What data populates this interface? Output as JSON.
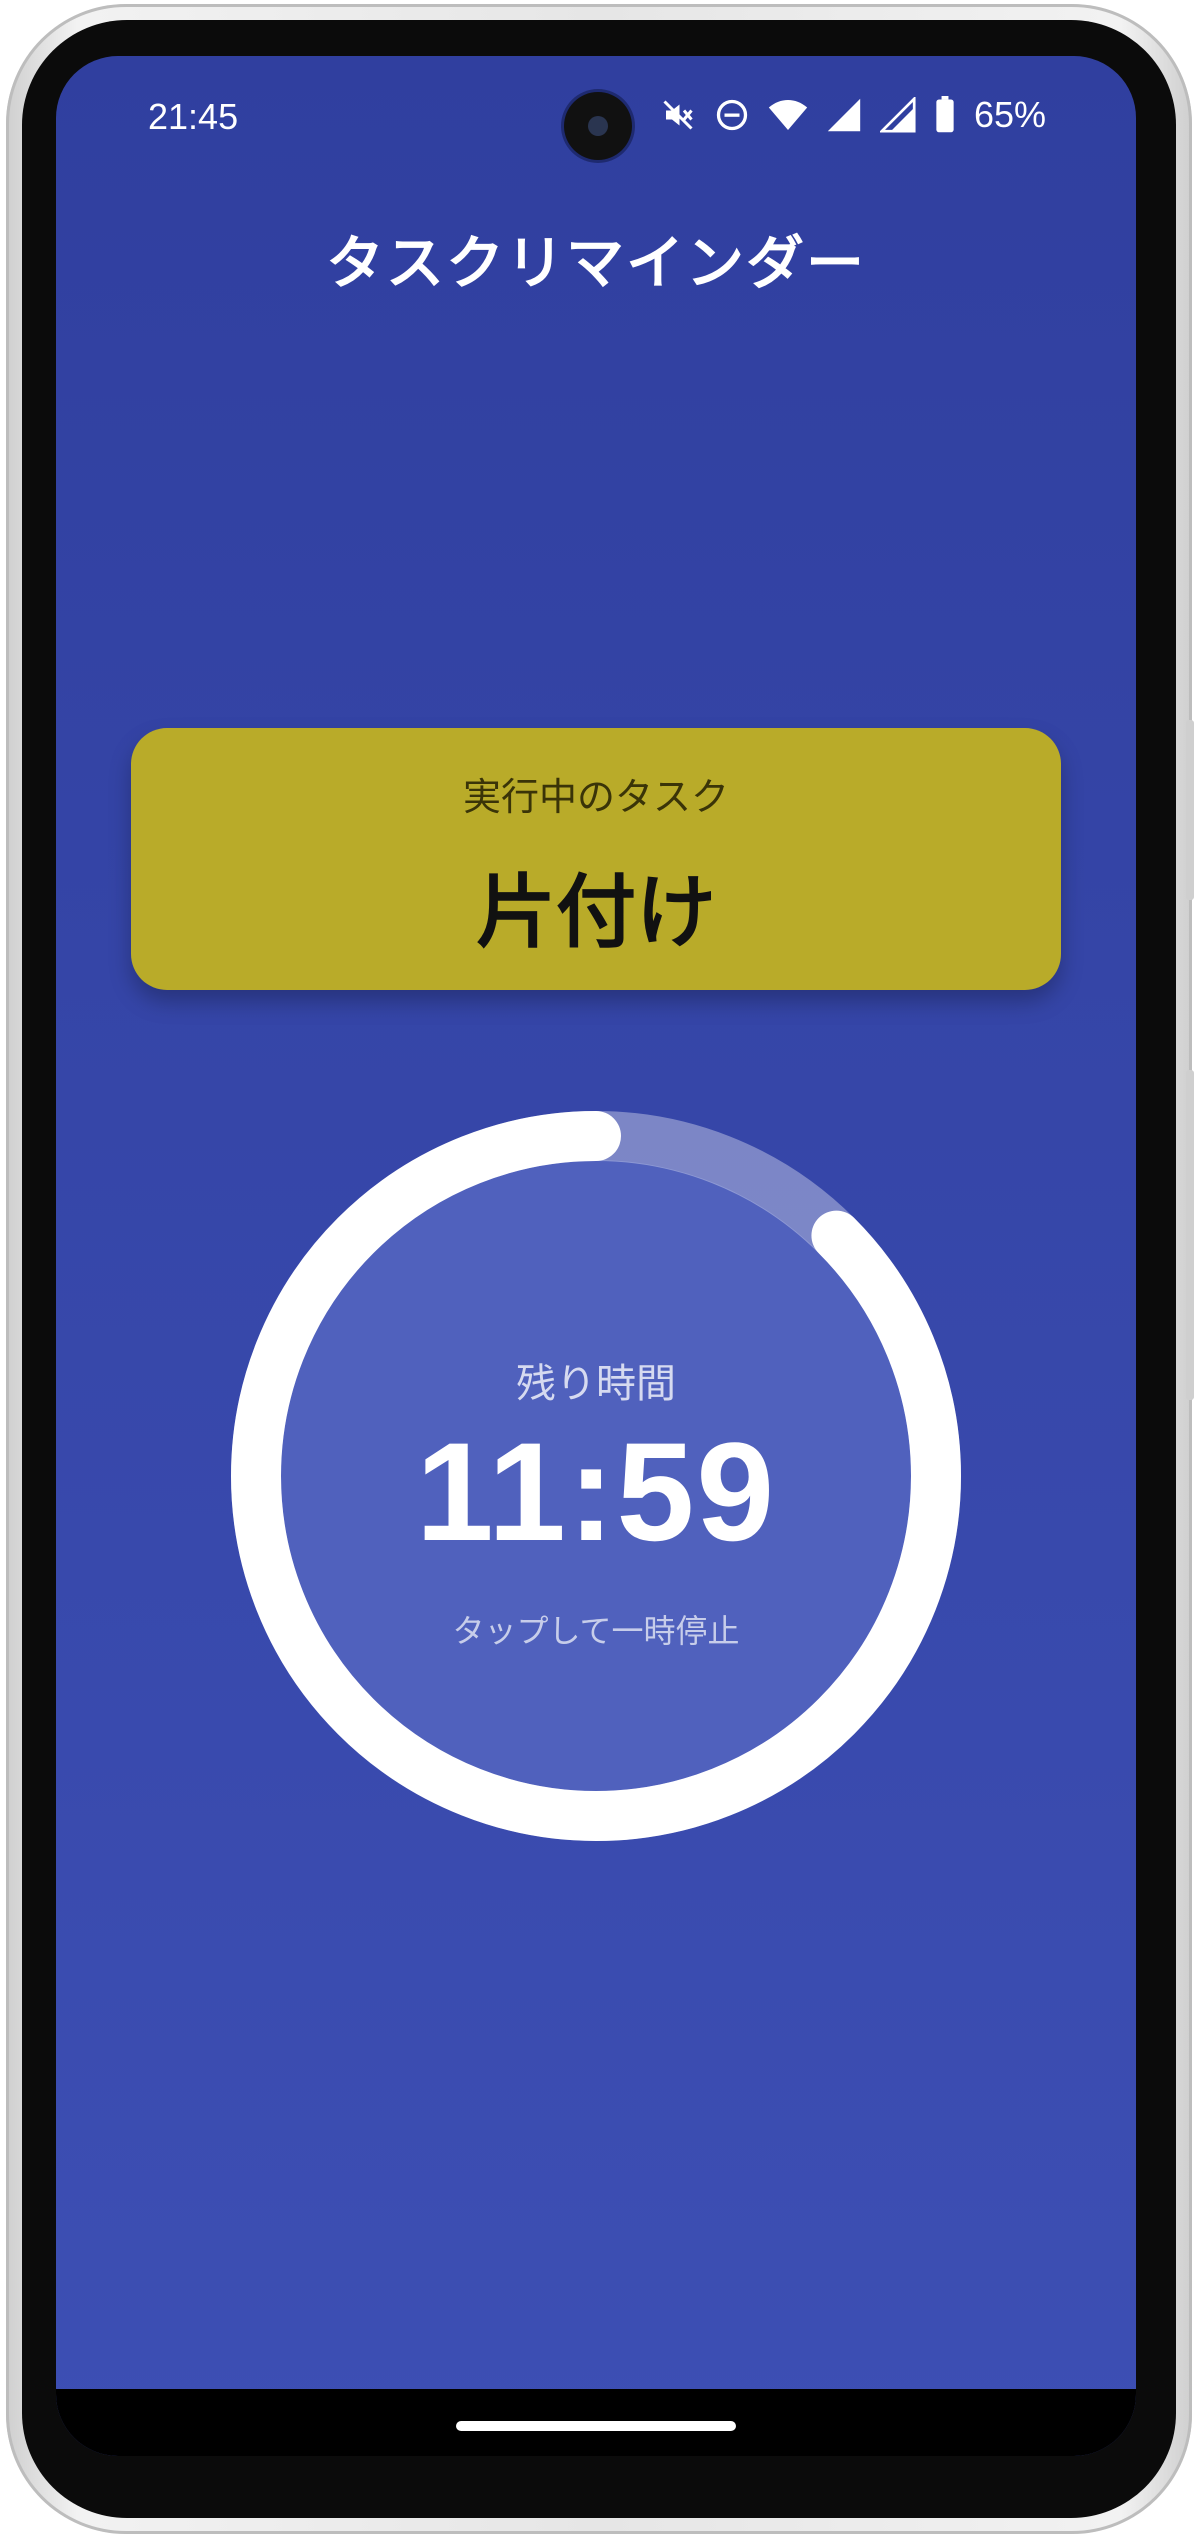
{
  "status_bar": {
    "time": "21:45",
    "battery_percent": "65%",
    "icons": [
      "mute-icon",
      "do-not-disturb-icon",
      "wifi-icon",
      "signal-icon",
      "signal-icon",
      "battery-icon"
    ]
  },
  "app": {
    "title": "タスクリマインダー"
  },
  "current_task": {
    "caption": "実行中のタスク",
    "name": "片付け"
  },
  "timer": {
    "label": "残り時間",
    "remaining": "11:59",
    "hint": "タップして一時停止",
    "progress_fraction": 0.875
  },
  "colors": {
    "background_top": "#303f9f",
    "background_bottom": "#3d4fb4",
    "task_card": "#b9ab29",
    "ring": "#ffffff"
  }
}
